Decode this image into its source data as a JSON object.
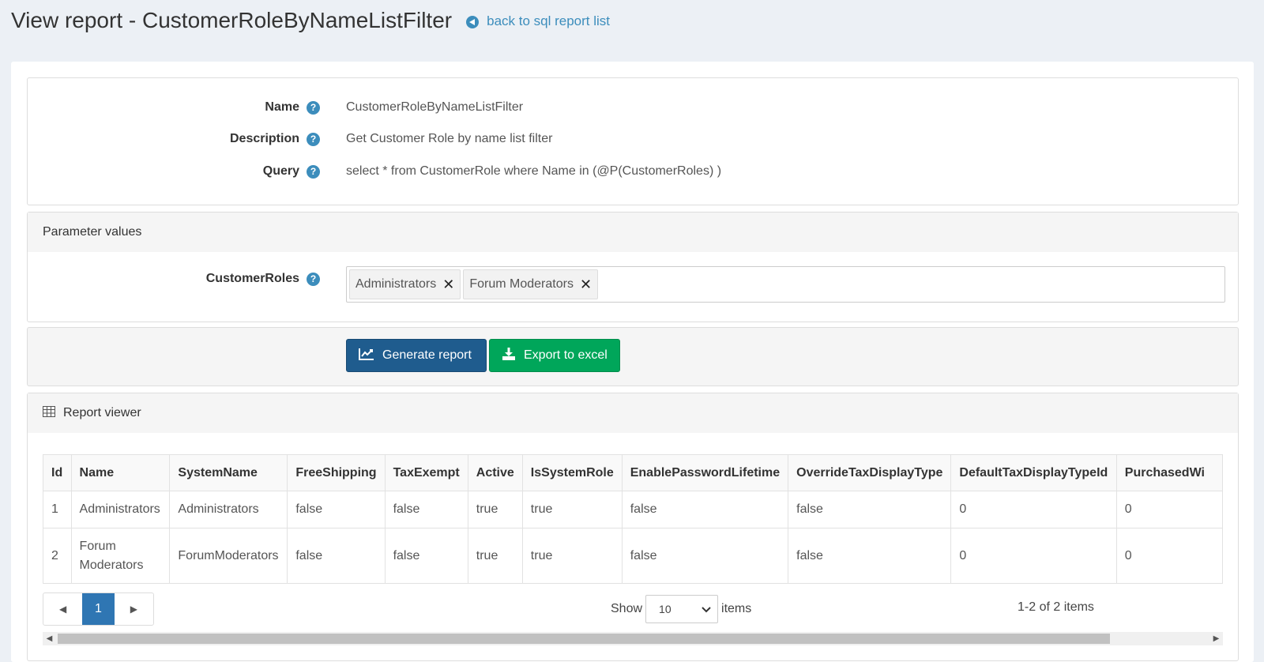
{
  "header": {
    "title": "View report - CustomerRoleByNameListFilter",
    "back_link": "back to sql report list"
  },
  "info": {
    "name_label": "Name",
    "name_value": "CustomerRoleByNameListFilter",
    "description_label": "Description",
    "description_value": "Get Customer Role by name list filter",
    "query_label": "Query",
    "query_value": "select * from CustomerRole where Name in (@P(CustomerRoles) )"
  },
  "parameters": {
    "heading": "Parameter values",
    "field_label": "CustomerRoles",
    "selected": [
      "Administrators",
      "Forum Moderators"
    ]
  },
  "actions": {
    "generate_label": "Generate report",
    "export_label": "Export to excel"
  },
  "report": {
    "heading": "Report viewer",
    "columns": [
      "Id",
      "Name",
      "SystemName",
      "FreeShipping",
      "TaxExempt",
      "Active",
      "IsSystemRole",
      "EnablePasswordLifetime",
      "OverrideTaxDisplayType",
      "DefaultTaxDisplayTypeId",
      "PurchasedWi"
    ],
    "rows": [
      [
        "1",
        "Administrators",
        "Administrators",
        "false",
        "false",
        "true",
        "true",
        "false",
        "false",
        "0",
        "0"
      ],
      [
        "2",
        "Forum Moderators",
        "ForumModerators",
        "false",
        "false",
        "true",
        "true",
        "false",
        "false",
        "0",
        "0"
      ]
    ]
  },
  "pager": {
    "current_page": "1",
    "show_label": "Show",
    "page_size": "10",
    "items_label": "items",
    "info": "1-2 of 2 items"
  },
  "colors": {
    "accent": "#3c8dbc",
    "primary_button": "#1f5c8e",
    "success_button": "#00a65a"
  }
}
